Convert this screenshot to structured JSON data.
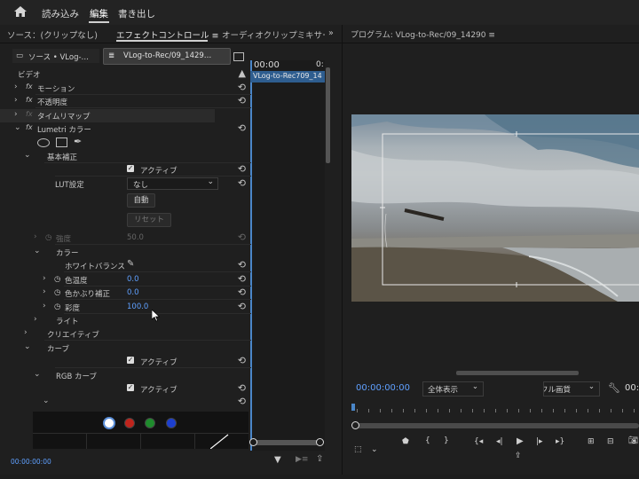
{
  "workspaces": [
    "読み込み",
    "編集",
    "書き出し"
  ],
  "left_tabs": [
    "ソース：(クリップなし)",
    "エフェクトコントロール ≡",
    "オーディオクリップミキサー"
  ],
  "subtabs": {
    "source": "ソース • VLog-…",
    "sequence": "VLog-to-Rec/09_1429…"
  },
  "timeline": {
    "time": "00:00",
    "clip": "VLog-to-Rec709_14",
    "end": "0:"
  },
  "tree": {
    "video": "ビデオ",
    "motion": "モーション",
    "opacity": "不透明度",
    "timeremap": "タイムリマップ",
    "lumetri": "Lumetri カラー",
    "basic": "基本補正",
    "active": "アクティブ",
    "lut_label": "LUT設定",
    "lut_value": "なし",
    "auto": "自動",
    "reset": "リセット",
    "intensity": "強度",
    "intensity_value": "50.0",
    "color": "カラー",
    "wb": "ホワイトバランス",
    "temp": "色温度",
    "temp_value": "0.0",
    "tint": "色かぶり補正",
    "tint_value": "0.0",
    "saturation": "彩度",
    "saturation_value": "100.0",
    "light": "ライト",
    "creative": "クリエイティブ",
    "curves": "カーブ",
    "active2": "アクティブ",
    "rgb": "RGB カーブ",
    "active3": "アクティブ"
  },
  "left_time": "00:00:00:00",
  "program": {
    "title": "プログラム: VLog-to-Rec/09_14290 ≡",
    "timecode": "00:00:00:00",
    "fit": "全体表示",
    "quality": "フル画質",
    "right_time": "00:"
  },
  "curve_channels": [
    "#ffffff",
    "#c0241c",
    "#1f8c2d",
    "#1d3fcf"
  ]
}
